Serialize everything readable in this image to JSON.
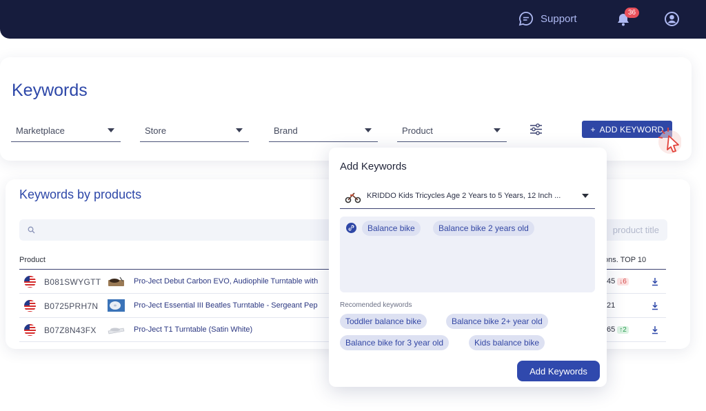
{
  "topbar": {
    "support_label": "Support",
    "notifications_count": "36",
    "icons": [
      "chat-icon",
      "bell-icon",
      "user-icon"
    ]
  },
  "keywords_page": {
    "title": "Keywords",
    "filters": [
      "Marketplace",
      "Store",
      "Brand",
      "Product"
    ],
    "add_keyword_label": "ADD KEYWORD"
  },
  "products_section": {
    "title": "Keywords by products",
    "search_placeholder": "product title",
    "col_product": "Product",
    "col_right": "ons. TOP 10",
    "rows": [
      {
        "asin": "B081SWYGTT",
        "title": "Pro-Ject Debut Carbon EVO, Audiophile Turntable with",
        "value": "45",
        "change": "↓6",
        "change_dir": "down"
      },
      {
        "asin": "B0725PRH7N",
        "title": "Pro-Ject Essential III Beatles Turntable - Sergeant Pep",
        "value": "21",
        "change": "",
        "change_dir": ""
      },
      {
        "asin": "B07Z8N43FX",
        "title": "Pro-Ject T1 Turntable (Satin White)",
        "value": "65",
        "change": "↑2",
        "change_dir": "up"
      }
    ]
  },
  "modal": {
    "title": "Add Keywords",
    "product": "KRIDDO Kids Tricycles Age 2 Years to 5 Years, 12 Inch ...",
    "keywords": [
      "Balance bike",
      "Balance bike 2 years old"
    ],
    "recommended_label": "Recomended keywords",
    "recommended": [
      "Toddler balance bike",
      "Balance bike 2+ year old",
      "Balance bike for 3 year old",
      "Kids balance bike"
    ],
    "submit_label": "Add Keywords"
  },
  "colors": {
    "nav_bg": "#161c3d",
    "accent": "#2f47a6",
    "chip_bg": "#dde1f2",
    "badge": "#e8505b"
  }
}
